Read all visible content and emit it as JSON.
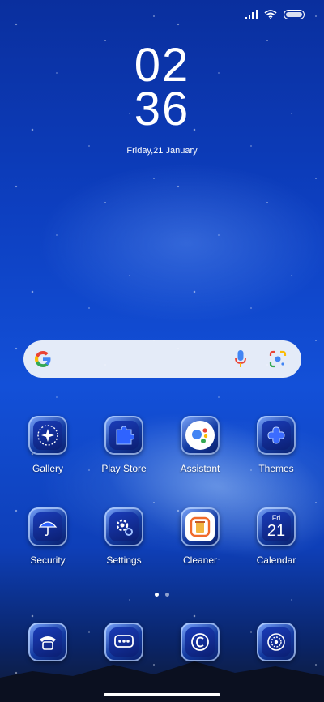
{
  "status_bar": {
    "icons": [
      "signal-icon",
      "wifi-icon",
      "battery-icon"
    ]
  },
  "clock": {
    "hours": "02",
    "minutes": "36",
    "date": "Friday,21 January"
  },
  "search_bar": {
    "icons": [
      "google-logo-icon",
      "microphone-icon",
      "google-lens-icon"
    ]
  },
  "apps_row1": [
    {
      "label": "Gallery",
      "icon": "gallery-icon"
    },
    {
      "label": "Play Store",
      "icon": "play-store-icon"
    },
    {
      "label": "Assistant",
      "icon": "assistant-icon"
    },
    {
      "label": "Themes",
      "icon": "themes-icon"
    }
  ],
  "apps_row2": [
    {
      "label": "Security",
      "icon": "umbrella-icon"
    },
    {
      "label": "Settings",
      "icon": "settings-icon"
    },
    {
      "label": "Cleaner",
      "icon": "cleaner-icon"
    },
    {
      "label": "Calendar",
      "icon": "calendar-icon",
      "day_name": "Fri",
      "day_number": "21"
    }
  ],
  "dock": [
    {
      "icon": "phone-icon"
    },
    {
      "icon": "messages-icon"
    },
    {
      "icon": "browser-icon"
    },
    {
      "icon": "camera-icon"
    }
  ],
  "page_indicator": {
    "pages": 2,
    "current": 1
  },
  "colors": {
    "wallpaper_top": "#0a2f9e",
    "wallpaper_mid": "#1350d8",
    "icon_frame": "#7fa9ff",
    "search_bg": "#f0f3fa"
  }
}
